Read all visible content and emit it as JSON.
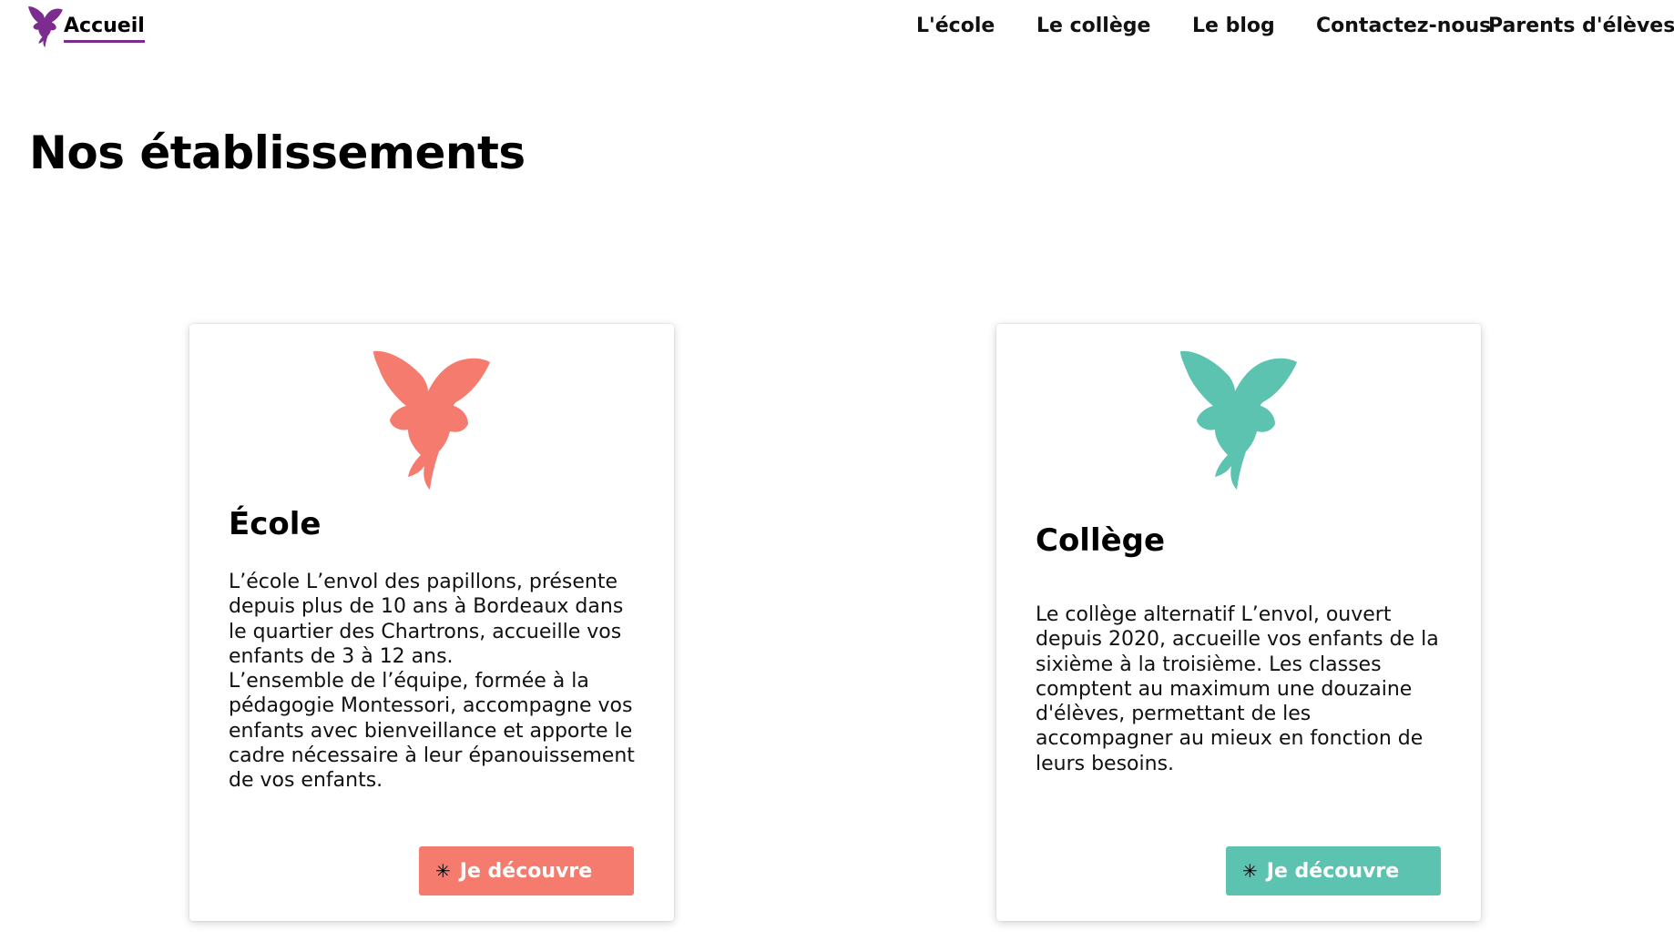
{
  "colors": {
    "brand_purple": "#7b2c8e",
    "coral": "#f47b6d",
    "teal": "#5cc3b0"
  },
  "header": {
    "logo_icon": "butterfly-fairy-icon",
    "home_label": "Accueil",
    "nav": [
      {
        "label": "L'école"
      },
      {
        "label": "Le collège"
      },
      {
        "label": "Le blog"
      },
      {
        "label": "Contactez-nous"
      },
      {
        "label": "Parents d'élèves"
      }
    ]
  },
  "main": {
    "title": "Nos établissements",
    "cards": [
      {
        "icon": "butterfly-fairy-icon",
        "icon_color": "#f47b6d",
        "title": "École",
        "text": "L’école L’envol des papillons, présente depuis plus de 10 ans à Bordeaux dans le quartier des Chartrons, accueille vos enfants de 3 à 12 ans.\nL’ensemble de l’équipe, formée à la pédagogie Montessori, accompagne vos enfants avec bienveillance et apporte le cadre nécessaire à leur épanouissement de vos enfants.",
        "button_icon": "asterisk-icon",
        "button_label": "Je découvre"
      },
      {
        "icon": "butterfly-fairy-icon",
        "icon_color": "#5cc3b0",
        "title": "Collège",
        "text": "Le collège alternatif L’envol, ouvert depuis 2020, accueille vos enfants de la sixième à la troisième. Les classes comptent au maximum une douzaine d'élèves, permettant de les accompagner au mieux en fonction de leurs besoins.",
        "button_icon": "asterisk-icon",
        "button_label": "Je découvre"
      }
    ]
  }
}
